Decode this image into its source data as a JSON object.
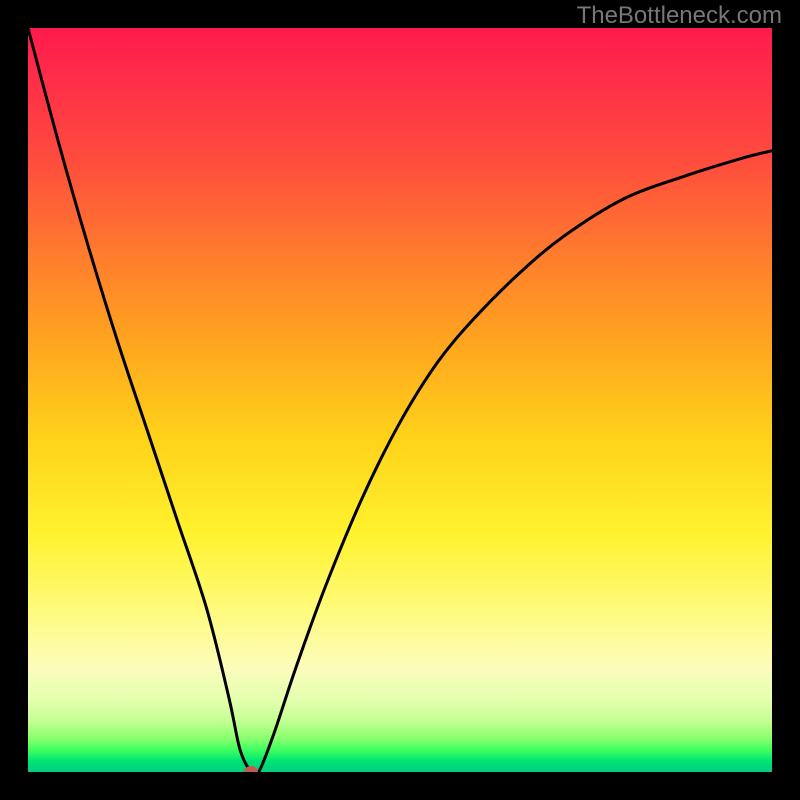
{
  "watermark": "TheBottleneck.com",
  "chart_data": {
    "type": "line",
    "title": "",
    "xlabel": "",
    "ylabel": "",
    "xlim": [
      0,
      100
    ],
    "ylim": [
      0,
      100
    ],
    "series": [
      {
        "name": "curve",
        "x": [
          0,
          4,
          8,
          12,
          16,
          20,
          24,
          27,
          28.5,
          30,
          31,
          33,
          36,
          40,
          45,
          50,
          55,
          60,
          66,
          72,
          80,
          88,
          96,
          100
        ],
        "y": [
          100,
          85,
          71,
          58,
          46,
          34,
          22,
          10,
          3,
          0,
          0,
          5,
          14,
          25,
          37,
          47,
          55,
          61,
          67,
          72,
          77,
          80,
          82.5,
          83.5
        ]
      }
    ],
    "marker": {
      "x": 30,
      "y": 0,
      "color": "#c45a4d"
    },
    "background_gradient": {
      "top": "#ff1a4d",
      "mid": "#ffd21a",
      "bottom": "#00cc82"
    }
  }
}
